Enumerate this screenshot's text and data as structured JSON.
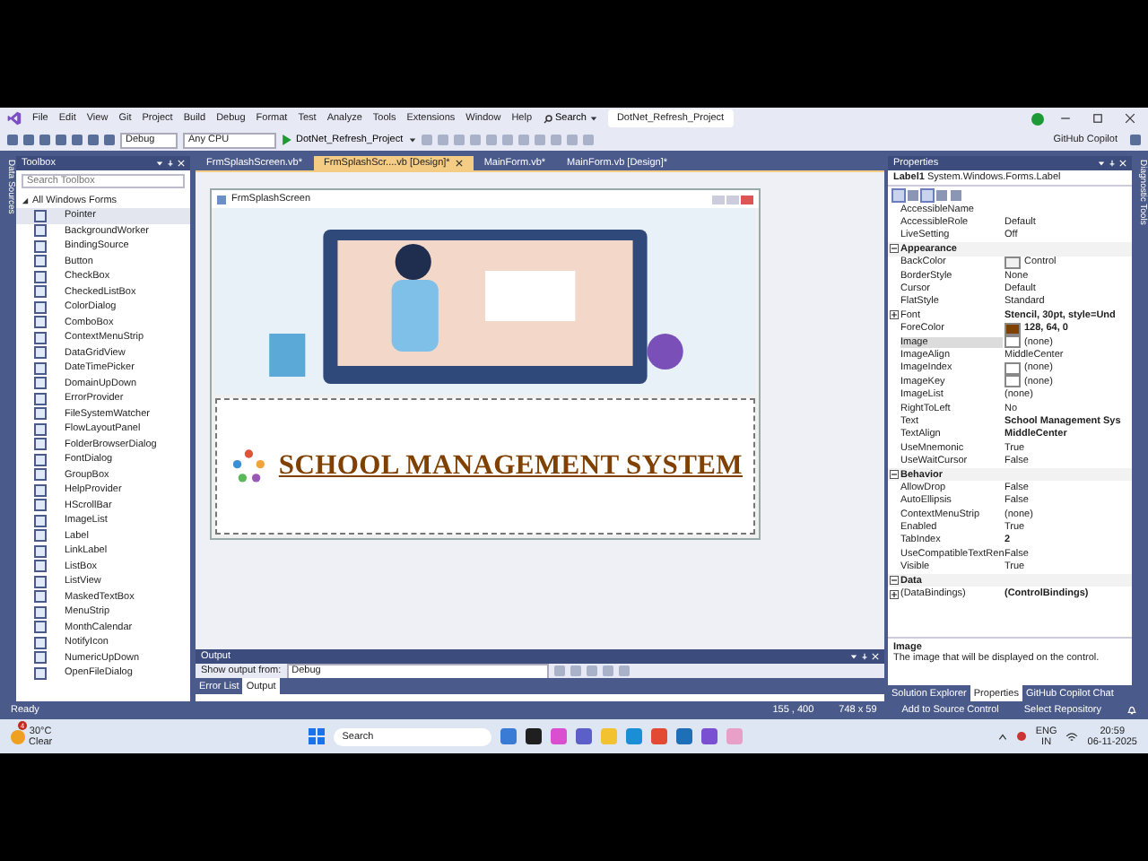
{
  "menu": [
    "File",
    "Edit",
    "View",
    "Git",
    "Project",
    "Build",
    "Debug",
    "Format",
    "Test",
    "Analyze",
    "Tools",
    "Extensions",
    "Window",
    "Help"
  ],
  "search": {
    "label": "Search"
  },
  "solution_title": "DotNet_Refresh_Project",
  "toolbar": {
    "configuration": "Debug",
    "platform": "Any CPU",
    "start": "DotNet_Refresh_Project",
    "copilot": "GitHub Copilot"
  },
  "side_strips": {
    "left": "Data Sources",
    "right": "Diagnostic Tools"
  },
  "toolbox": {
    "title": "Toolbox",
    "search_placeholder": "Search Toolbox",
    "group": {
      "label": "All Windows Forms",
      "expanded": true,
      "items": [
        {
          "label": "Pointer",
          "selected": true
        },
        {
          "label": "BackgroundWorker",
          "selected": false
        },
        {
          "label": "BindingSource",
          "selected": false
        },
        {
          "label": "Button",
          "selected": false
        },
        {
          "label": "CheckBox",
          "selected": false
        },
        {
          "label": "CheckedListBox",
          "selected": false
        },
        {
          "label": "ColorDialog",
          "selected": false
        },
        {
          "label": "ComboBox",
          "selected": false
        },
        {
          "label": "ContextMenuStrip",
          "selected": false
        },
        {
          "label": "DataGridView",
          "selected": false
        },
        {
          "label": "DateTimePicker",
          "selected": false
        },
        {
          "label": "DomainUpDown",
          "selected": false
        },
        {
          "label": "ErrorProvider",
          "selected": false
        },
        {
          "label": "FileSystemWatcher",
          "selected": false
        },
        {
          "label": "FlowLayoutPanel",
          "selected": false
        },
        {
          "label": "FolderBrowserDialog",
          "selected": false
        },
        {
          "label": "FontDialog",
          "selected": false
        },
        {
          "label": "GroupBox",
          "selected": false
        },
        {
          "label": "HelpProvider",
          "selected": false
        },
        {
          "label": "HScrollBar",
          "selected": false
        },
        {
          "label": "ImageList",
          "selected": false
        },
        {
          "label": "Label",
          "selected": false
        },
        {
          "label": "LinkLabel",
          "selected": false
        },
        {
          "label": "ListBox",
          "selected": false
        },
        {
          "label": "ListView",
          "selected": false
        },
        {
          "label": "MaskedTextBox",
          "selected": false
        },
        {
          "label": "MenuStrip",
          "selected": false
        },
        {
          "label": "MonthCalendar",
          "selected": false
        },
        {
          "label": "NotifyIcon",
          "selected": false
        },
        {
          "label": "NumericUpDown",
          "selected": false
        },
        {
          "label": "OpenFileDialog",
          "selected": false
        }
      ]
    }
  },
  "doc_tabs": [
    {
      "label": "FrmSplashScreen.vb*",
      "selected": false
    },
    {
      "label": "FrmSplashScr....vb [Design]*",
      "selected": true
    },
    {
      "label": "MainForm.vb*",
      "selected": false
    },
    {
      "label": "MainForm.vb [Design]*",
      "selected": false
    }
  ],
  "designer": {
    "form_title": "FrmSplashScreen",
    "label_text": "SCHOOL MANAGEMENT SYSTEM"
  },
  "output": {
    "title": "Output",
    "show_from": "Show output from:",
    "source": "Debug",
    "tabs": [
      {
        "label": "Error List",
        "selected": false
      },
      {
        "label": "Output",
        "selected": true
      }
    ]
  },
  "properties": {
    "title": "Properties",
    "object_name": "Label1",
    "object_type": "System.Windows.Forms.Label",
    "rows": [
      {
        "kind": "property",
        "name": "AccessibleName",
        "value": "",
        "selected": false
      },
      {
        "kind": "property",
        "name": "AccessibleRole",
        "value": "Default",
        "selected": false
      },
      {
        "kind": "property",
        "name": "LiveSetting",
        "value": "Off",
        "selected": false
      },
      {
        "kind": "category",
        "name": "Appearance",
        "expanded": true
      },
      {
        "kind": "property",
        "name": "BackColor",
        "value": "Control",
        "color": "#f0f0f0",
        "selected": false
      },
      {
        "kind": "property",
        "name": "BorderStyle",
        "value": "None",
        "selected": false
      },
      {
        "kind": "property",
        "name": "Cursor",
        "value": "Default",
        "selected": false
      },
      {
        "kind": "property",
        "name": "FlatStyle",
        "value": "Standard",
        "selected": false
      },
      {
        "kind": "property",
        "name": "Font",
        "value": "Stencil, 30pt, style=Und",
        "modified": true,
        "expandable": true,
        "selected": false
      },
      {
        "kind": "property",
        "name": "ForeColor",
        "value": "128, 64, 0",
        "modified": true,
        "color": "#804000",
        "selected": false
      },
      {
        "kind": "property",
        "name": "Image",
        "value": "(none)",
        "color": "#ffffff",
        "selected": true
      },
      {
        "kind": "property",
        "name": "ImageAlign",
        "value": "MiddleCenter",
        "selected": false
      },
      {
        "kind": "property",
        "name": "ImageIndex",
        "value": "(none)",
        "color": "#ffffff",
        "selected": false
      },
      {
        "kind": "property",
        "name": "ImageKey",
        "value": "(none)",
        "color": "#ffffff",
        "selected": false
      },
      {
        "kind": "property",
        "name": "ImageList",
        "value": "(none)",
        "selected": false
      },
      {
        "kind": "property",
        "name": "RightToLeft",
        "value": "No",
        "selected": false
      },
      {
        "kind": "property",
        "name": "Text",
        "value": "School Management Sys",
        "modified": true,
        "selected": false
      },
      {
        "kind": "property",
        "name": "TextAlign",
        "value": "MiddleCenter",
        "modified": true,
        "selected": false
      },
      {
        "kind": "property",
        "name": "UseMnemonic",
        "value": "True",
        "selected": false
      },
      {
        "kind": "property",
        "name": "UseWaitCursor",
        "value": "False",
        "selected": false
      },
      {
        "kind": "category",
        "name": "Behavior",
        "expanded": true
      },
      {
        "kind": "property",
        "name": "AllowDrop",
        "value": "False",
        "selected": false
      },
      {
        "kind": "property",
        "name": "AutoEllipsis",
        "value": "False",
        "selected": false
      },
      {
        "kind": "property",
        "name": "ContextMenuStrip",
        "value": "(none)",
        "selected": false
      },
      {
        "kind": "property",
        "name": "Enabled",
        "value": "True",
        "selected": false
      },
      {
        "kind": "property",
        "name": "TabIndex",
        "value": "2",
        "modified": true,
        "selected": false
      },
      {
        "kind": "property",
        "name": "UseCompatibleTextRen",
        "value": "False",
        "selected": false
      },
      {
        "kind": "property",
        "name": "Visible",
        "value": "True",
        "selected": false
      },
      {
        "kind": "category",
        "name": "Data",
        "expanded": true
      },
      {
        "kind": "property",
        "name": "(DataBindings)",
        "value": "(ControlBindings)",
        "modified": true,
        "expandable": true,
        "selected": false
      }
    ],
    "description": {
      "title": "Image",
      "text": "The image that will be displayed on the control."
    },
    "tabs": [
      {
        "label": "Solution Explorer",
        "selected": false
      },
      {
        "label": "Properties",
        "selected": true
      },
      {
        "label": "GitHub Copilot Chat",
        "selected": false
      }
    ]
  },
  "status_bar": {
    "ready": "Ready",
    "position": "155 , 400",
    "size": "748 x 59",
    "source_control": "Add to Source Control",
    "repository": "Select Repository"
  },
  "taskbar": {
    "temperature": "30°C",
    "condition": "Clear",
    "badge": "4",
    "search": "Search",
    "language": "ENG",
    "region": "IN",
    "time": "20:59",
    "date": "06-11-2025"
  }
}
